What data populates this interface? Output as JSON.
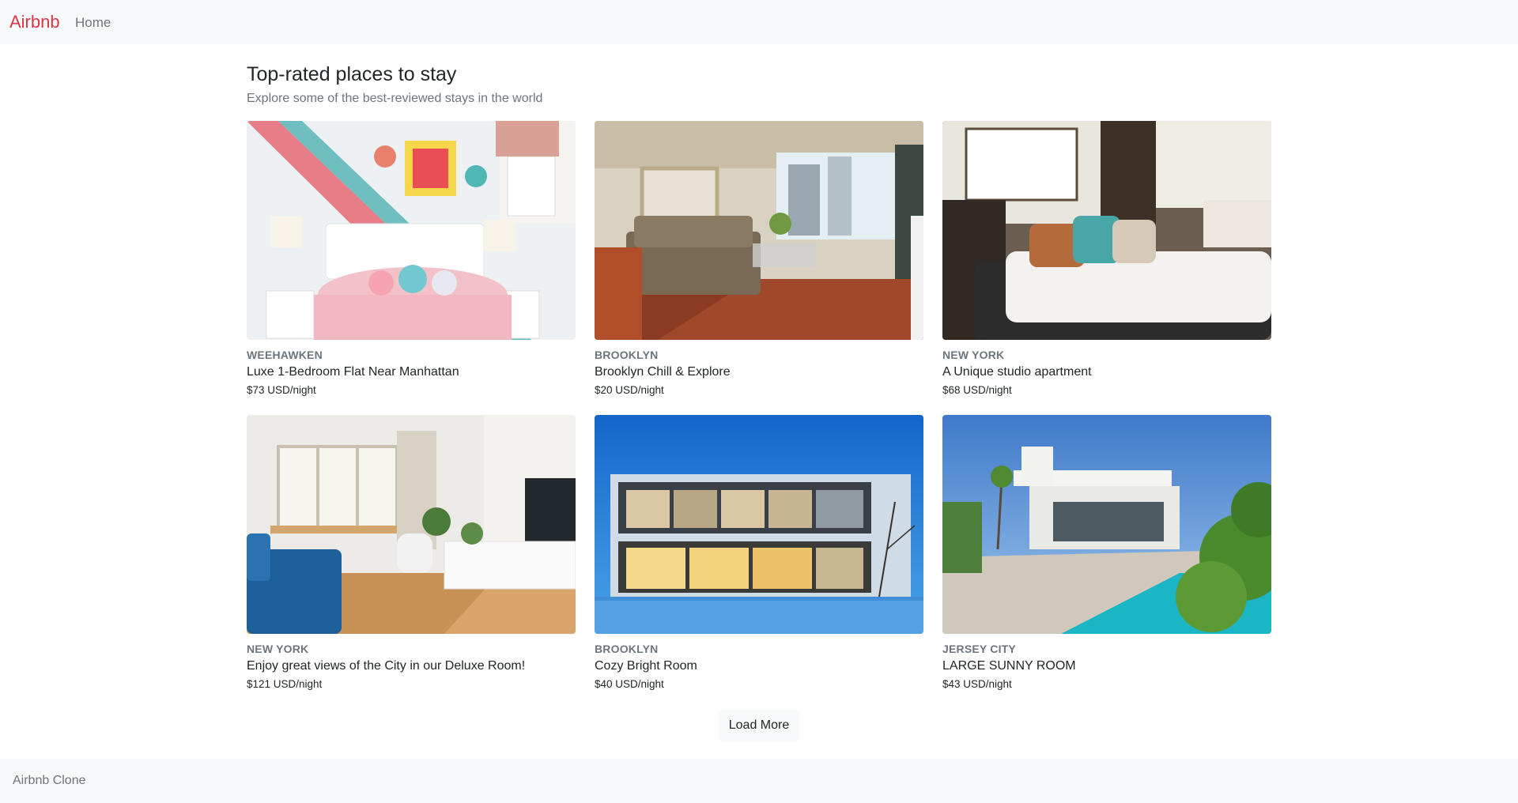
{
  "nav": {
    "brand": "Airbnb",
    "home": "Home"
  },
  "page": {
    "title": "Top-rated places to stay",
    "subtitle": "Explore some of the best-reviewed stays in the world"
  },
  "listings": [
    {
      "location": "WEEHAWKEN",
      "title": "Luxe 1-Bedroom Flat Near Manhattan",
      "price": "$73 USD/night"
    },
    {
      "location": "BROOKLYN",
      "title": "Brooklyn Chill & Explore",
      "price": "$20 USD/night"
    },
    {
      "location": "NEW YORK",
      "title": "A Unique studio apartment",
      "price": "$68 USD/night"
    },
    {
      "location": "NEW YORK",
      "title": "Enjoy great views of the City in our Deluxe Room!",
      "price": "$121 USD/night"
    },
    {
      "location": "BROOKLYN",
      "title": "Cozy Bright Room",
      "price": "$40 USD/night"
    },
    {
      "location": "JERSEY CITY",
      "title": "LARGE SUNNY ROOM",
      "price": "$43 USD/night"
    }
  ],
  "load_more_label": "Load More",
  "footer": {
    "text": "Airbnb Clone"
  },
  "colors": {
    "brand": "#dc3545",
    "muted": "#6c757d",
    "light_bg": "#f8f9fa"
  }
}
